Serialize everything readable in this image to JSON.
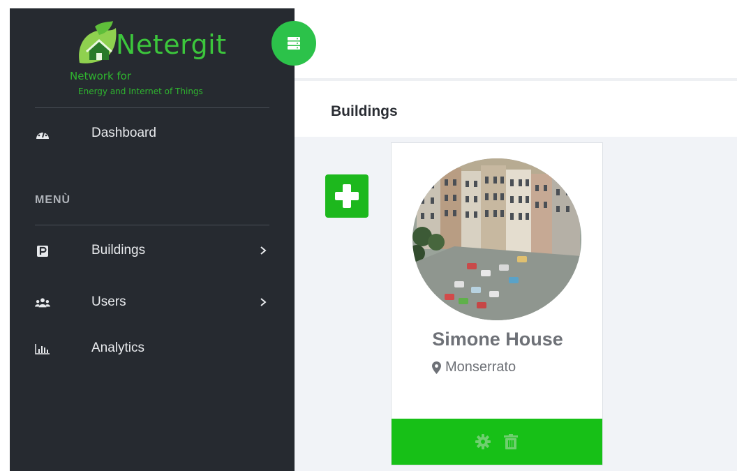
{
  "brand": {
    "name": "Netergit",
    "subtitle_line1": "Network for",
    "subtitle_line2": "Energy and Internet of Things",
    "color": "#3cc63c"
  },
  "sidebar": {
    "dashboard": {
      "label": "Dashboard",
      "icon": "tachometer-icon"
    },
    "menu_heading": "MENÙ",
    "items": [
      {
        "label": "Buildings",
        "icon": "parking-icon",
        "has_submenu": true
      },
      {
        "label": "Users",
        "icon": "users-icon",
        "has_submenu": true
      },
      {
        "label": "Analytics",
        "icon": "bar-chart-icon",
        "has_submenu": false
      }
    ]
  },
  "header": {
    "toggle_icon": "server-icon"
  },
  "page": {
    "title": "Buildings"
  },
  "buildings": [
    {
      "name": "Simone House",
      "location": "Monserrato",
      "location_icon": "map-marker-icon",
      "actions": [
        "settings-icon",
        "trash-icon"
      ]
    }
  ],
  "colors": {
    "sidebar_bg": "#262a30",
    "accent_green": "#1db81d",
    "content_bg": "#f1f3f7"
  }
}
